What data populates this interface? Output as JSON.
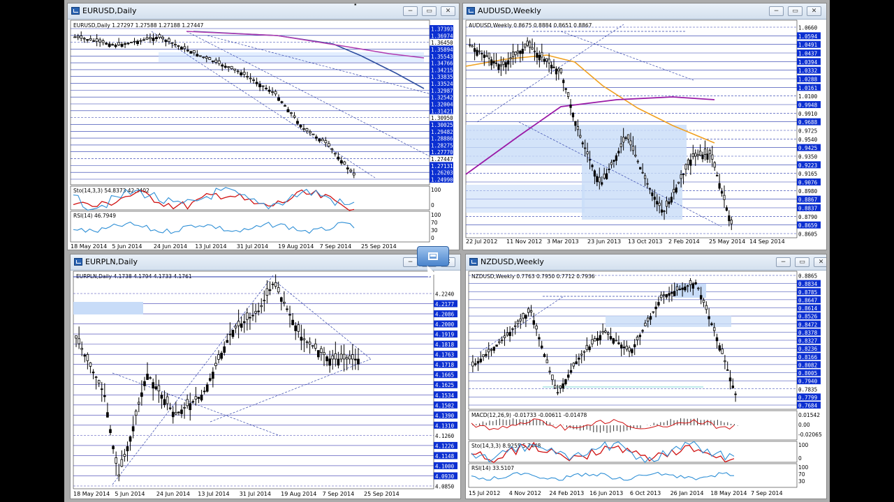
{
  "windows": [
    {
      "id": "eurusd",
      "title": "EURUSD,Daily",
      "info": "EURUSD,Daily  1.27297 1.27588 1.27188 1.27447",
      "price_labels": [
        "1.37393",
        "1.36974",
        "1.36450",
        "1.35894",
        "1.35543",
        "1.34766",
        "1.34215",
        "1.33835",
        "1.33524",
        "1.32987",
        "1.32542",
        "1.32004",
        "1.31421",
        "1.30950",
        "1.30025",
        "1.29482",
        "1.28886",
        "1.28275",
        "1.27770",
        "1.27447",
        "1.27131",
        "1.26203",
        "1.24990"
      ],
      "date_labels": [
        "18 May 2014",
        "5 Jun 2014",
        "24 Jun 2014",
        "13 Jul 2014",
        "31 Jul 2014",
        "19 Aug 2014",
        "7 Sep 2014",
        "25 Sep 2014"
      ],
      "sub_indicators": [
        {
          "label": "Sto(14,3,3) 54.8373 42.3402",
          "levels": [
            "100",
            "0"
          ]
        },
        {
          "label": "RSI(14) 46.7949",
          "levels": [
            "100",
            "70",
            "30",
            "0"
          ]
        }
      ]
    },
    {
      "id": "audusd",
      "title": "AUDUSD,Weekly",
      "info": "AUDUSD,Weekly  0.8675 0.8884 0.8651 0.8867",
      "price_labels": [
        "1.0660",
        "1.0594",
        "1.0491",
        "1.0437",
        "1.0394",
        "1.0332",
        "1.0288",
        "1.0161",
        "1.0100",
        "0.9948",
        "0.9910",
        "0.9688",
        "0.9725",
        "0.9540",
        "0.9425",
        "0.9350",
        "0.9223",
        "0.9165",
        "0.9076",
        "0.8980",
        "0.8867",
        "0.8837",
        "0.8790",
        "0.8659",
        "0.8605"
      ],
      "date_labels": [
        "22 Jul 2012",
        "11 Nov 2012",
        "3 Mar 2013",
        "23 Jun 2013",
        "13 Oct 2013",
        "2 Feb 2014",
        "25 May 2014",
        "14 Sep 2014"
      ]
    },
    {
      "id": "eurpln",
      "title": "EURPLN,Daily",
      "info": "EURPLN,Daily  4.1738 4.1794 4.1733 4.1761",
      "price_labels": [
        "4.2240",
        "4.2177",
        "4.2086",
        "4.2000",
        "4.1919",
        "4.1818",
        "4.1763",
        "4.1718",
        "4.1665",
        "4.1625",
        "4.1534",
        "4.1502",
        "4.1390",
        "4.1310",
        "4.1260",
        "4.1226",
        "4.1148",
        "4.1000",
        "4.0930",
        "4.0850"
      ],
      "date_labels": [
        "18 May 2014",
        "5 Jun 2014",
        "24 Jun 2014",
        "13 Jul 2014",
        "31 Jul 2014",
        "19 Aug 2014",
        "7 Sep 2014",
        "25 Sep 2014"
      ]
    },
    {
      "id": "nzdusd",
      "title": "NZDUSD,Weekly",
      "info": "NZDUSD,Weekly  0.7763 0.7950 0.7712 0.7936",
      "price_labels": [
        "0.8865",
        "0.8834",
        "0.8785",
        "0.8647",
        "0.8614",
        "0.8526",
        "0.8472",
        "0.8378",
        "0.8327",
        "0.8236",
        "0.8166",
        "0.8082",
        "0.8005",
        "0.7940",
        "0.7835",
        "0.7799",
        "0.7684"
      ],
      "date_labels": [
        "15 Jul 2012",
        "4 Nov 2012",
        "24 Feb 2013",
        "16 Jun 2013",
        "6 Oct 2013",
        "26 Jan 2014",
        "18 May 2014",
        "7 Sep 2014"
      ],
      "sub_indicators": [
        {
          "label": "MACD(12,26,9) -0.01733 -0.00611 -0.01478",
          "levels": [
            "0.01542",
            "0.00",
            "-0.02065"
          ]
        },
        {
          "label": "Sto(14,3,3) 8.9255 5.7448",
          "levels": [
            "100",
            "0"
          ]
        },
        {
          "label": "RSI(14) 33.5107",
          "levels": [
            "100",
            "70",
            "30"
          ]
        }
      ]
    }
  ],
  "controls": {
    "minimize": "−",
    "restore": "▭",
    "close": "✕"
  }
}
